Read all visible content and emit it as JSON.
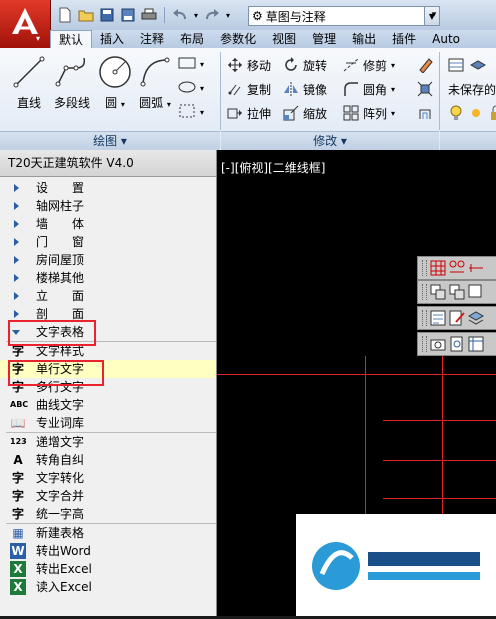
{
  "title_bar": {
    "workspace_selector": "草图与注释",
    "qat_icons": [
      "new-file-icon",
      "open-folder-icon",
      "save-icon",
      "save-as-icon",
      "print-icon",
      "undo-icon",
      "redo-icon"
    ]
  },
  "tabs": [
    "默认",
    "插入",
    "注释",
    "布局",
    "参数化",
    "视图",
    "管理",
    "输出",
    "插件",
    "Auto"
  ],
  "active_tab": "默认",
  "ribbon": {
    "draw_panel": {
      "buttons": [
        "直线",
        "多段线",
        "圆",
        "圆弧"
      ],
      "footer": "绘图 ▾"
    },
    "modify_panel": {
      "buttons": [
        [
          "移动",
          "旋转",
          "修剪"
        ],
        [
          "复制",
          "镜像",
          "圆角"
        ],
        [
          "拉伸",
          "缩放",
          "阵列"
        ]
      ],
      "footer": "修改 ▾"
    },
    "right_panel": {
      "unsaved_label": "未保存的"
    }
  },
  "palette": {
    "title": "T20天正建筑软件 V4.0",
    "categories": [
      "设　　置",
      "轴网柱子",
      "墙　　体",
      "门　　窗",
      "房间屋顶",
      "楼梯其他",
      "立　　面",
      "剖　　面"
    ],
    "open_category": "文字表格",
    "commands_group1": [
      {
        "icon": "字",
        "label": "文字样式"
      },
      {
        "icon": "字",
        "label": "单行文字"
      },
      {
        "icon": "字",
        "label": "多行文字"
      },
      {
        "icon": "ABC",
        "label": "曲线文字"
      },
      {
        "icon": "📖",
        "label": "专业词库"
      }
    ],
    "commands_group2": [
      {
        "icon": "123",
        "label": "递增文字"
      },
      {
        "icon": "A",
        "label": "转角自纠"
      },
      {
        "icon": "字",
        "label": "文字转化"
      },
      {
        "icon": "字",
        "label": "文字合并"
      },
      {
        "icon": "字",
        "label": "统一字高"
      }
    ],
    "commands_group3": [
      {
        "icon": "▦",
        "label": "新建表格"
      },
      {
        "icon": "W",
        "label": "转出Word"
      },
      {
        "icon": "X",
        "label": "转出Excel"
      },
      {
        "icon": "X",
        "label": "读入Excel"
      }
    ],
    "selected_command": "单行文字"
  },
  "canvas": {
    "view_label": "[-][俯视][二维线框]"
  },
  "colors": {
    "highlight_box": "#e8232f",
    "selected_row": "#ffffc2",
    "drawing_lines": "#e0202a",
    "app_red": "#c8211a"
  }
}
